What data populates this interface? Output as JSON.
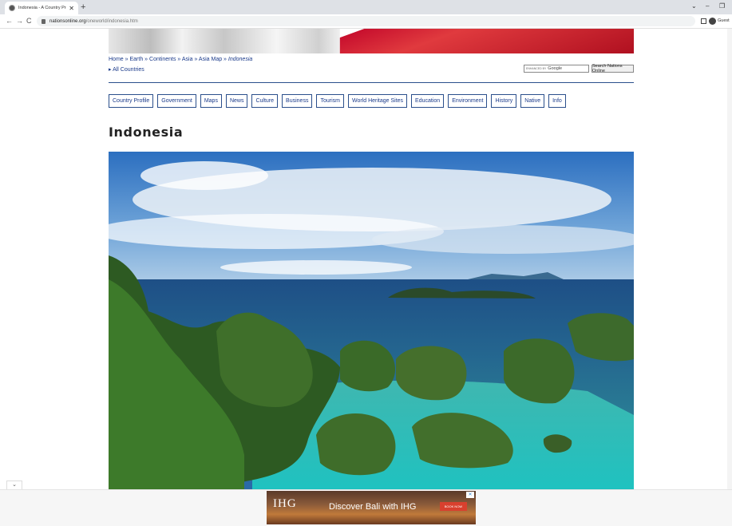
{
  "browser": {
    "tab_title": "Indonesia - A Country Profile - D",
    "tab_close": "✕",
    "new_tab": "+",
    "url_host": "nationsonline.org",
    "url_path": "/oneworld/indonesia.htm",
    "profile_label": "Guest",
    "nav_back": "←",
    "nav_forward": "→",
    "nav_reload": "C",
    "win_chevron": "⌄",
    "win_min": "–",
    "win_restore": "❐"
  },
  "breadcrumb": {
    "home": "Home",
    "earth": "Earth",
    "continents": "Continents",
    "asia": "Asia",
    "asia_map": "Asia Map",
    "current": "Indonesia",
    "sep": " » "
  },
  "all_countries": "▸ All Countries",
  "search": {
    "enhanced_by": "ENHANCED BY",
    "google": "Google",
    "button_label": "Search Nations Online"
  },
  "nav": [
    "Country Profile",
    "Government",
    "Maps",
    "News",
    "Culture",
    "Business",
    "Tourism",
    "World Heritage Sites",
    "Education",
    "Environment",
    "History",
    "Native",
    "Info"
  ],
  "page_title": "Indonesia",
  "collapse_glyph": "⌄",
  "ad": {
    "logo": "IHG",
    "headline": "Discover Bali with IHG",
    "cta": "BOOK NOW",
    "close": "✕"
  }
}
